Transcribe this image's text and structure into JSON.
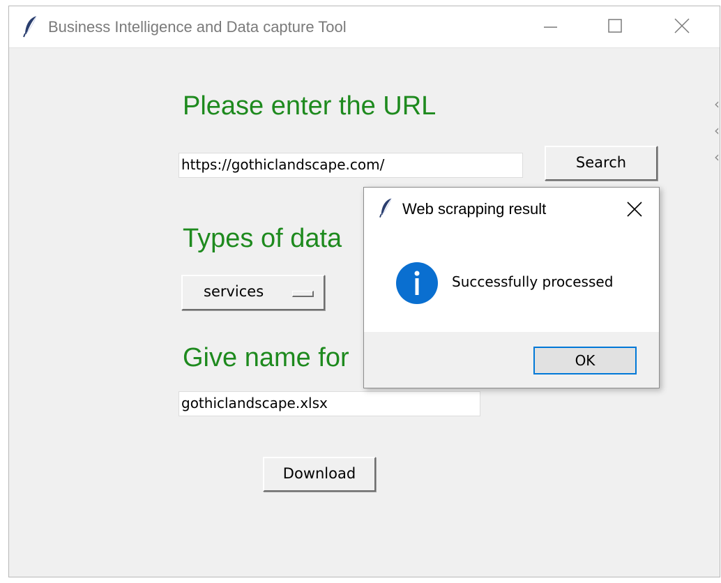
{
  "window": {
    "title": "Business Intelligence and Data capture Tool",
    "icon": "feather-icon"
  },
  "form": {
    "url_heading": "Please enter the URL",
    "url_value": "https://gothiclandscape.com/",
    "search_label": "Search",
    "types_heading": "Types of data",
    "types_selected": "services",
    "name_heading": "Give name for",
    "file_value": "gothiclandscape.xlsx",
    "download_label": "Download"
  },
  "dialog": {
    "title": "Web scrapping result",
    "message": "Successfully processed",
    "ok_label": "OK",
    "icon": "info-icon"
  },
  "colors": {
    "heading_green": "#1e8a1e",
    "info_blue": "#0a6fd0",
    "ok_border": "#0078d7"
  }
}
